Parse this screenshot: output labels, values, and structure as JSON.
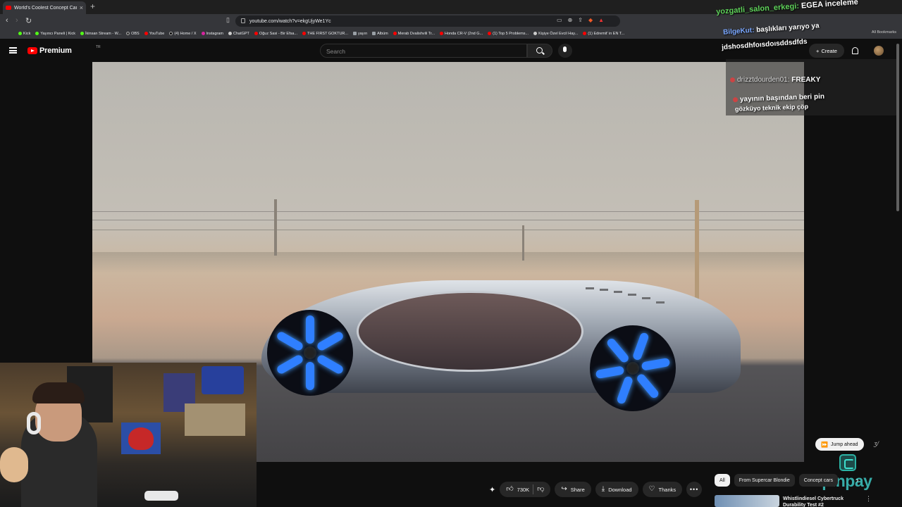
{
  "browser": {
    "tab_title": "World's Coolest Concept Car",
    "url": "youtube.com/watch?v=ekgUjyWe1Yc",
    "bookmarks": [
      "Kick",
      "Yayıncı Paneli | Kick",
      "İkinsan Stream - W...",
      "OBS",
      "YouTube",
      "(4) Home / X",
      "Instagram",
      "ChatGPT",
      "Oğuz Sasi - Bir Efsa...",
      "THE FIRST GOKTUR...",
      "yayın",
      "Albüm",
      "Merab Dvalishvili Tr...",
      "Honda CR-V (2nd G...",
      "(1) Top 5 Problems...",
      "Kişiye Özel Evcil Hay...",
      "(1) Edremit' in EN T..."
    ],
    "all_bookmarks": "All Bookmarks"
  },
  "youtube": {
    "brand": "Premium",
    "region": "TR",
    "search_placeholder": "Search",
    "create_label": "Create"
  },
  "chat": [
    {
      "user": "yozgatli_salon_erkegi:",
      "text": "EGEA inceleme"
    },
    {
      "user": "BilgeKut:",
      "text": "başlıkları yarıyo ya"
    },
    {
      "user": "",
      "text": "jdshosdhfoısdoısddsdfds"
    },
    {
      "user": "drizztdourden01:",
      "text": "FREAKY"
    },
    {
      "user": "",
      "text": "yayının başından beri pin"
    },
    {
      "user": "",
      "text": "gözküyo teknik ekip çöp"
    }
  ],
  "video": {
    "jump_ahead": "Jump ahead",
    "likes": "730K",
    "share": "Share",
    "download": "Download",
    "thanks": "Thanks"
  },
  "chips": [
    "All",
    "From Supercar Blondie",
    "Concept cars"
  ],
  "related": {
    "title": "Whistlindiesel Cybertruck Durability Test #2"
  },
  "sponsor": {
    "name": "epinpay"
  },
  "colors": {
    "youtube_red": "#ff0000",
    "chat_green": "#5fd35a",
    "chat_blue": "#7aa7ff",
    "epin_teal": "#3ec7c2",
    "wheel_glow": "#2f7fff"
  }
}
